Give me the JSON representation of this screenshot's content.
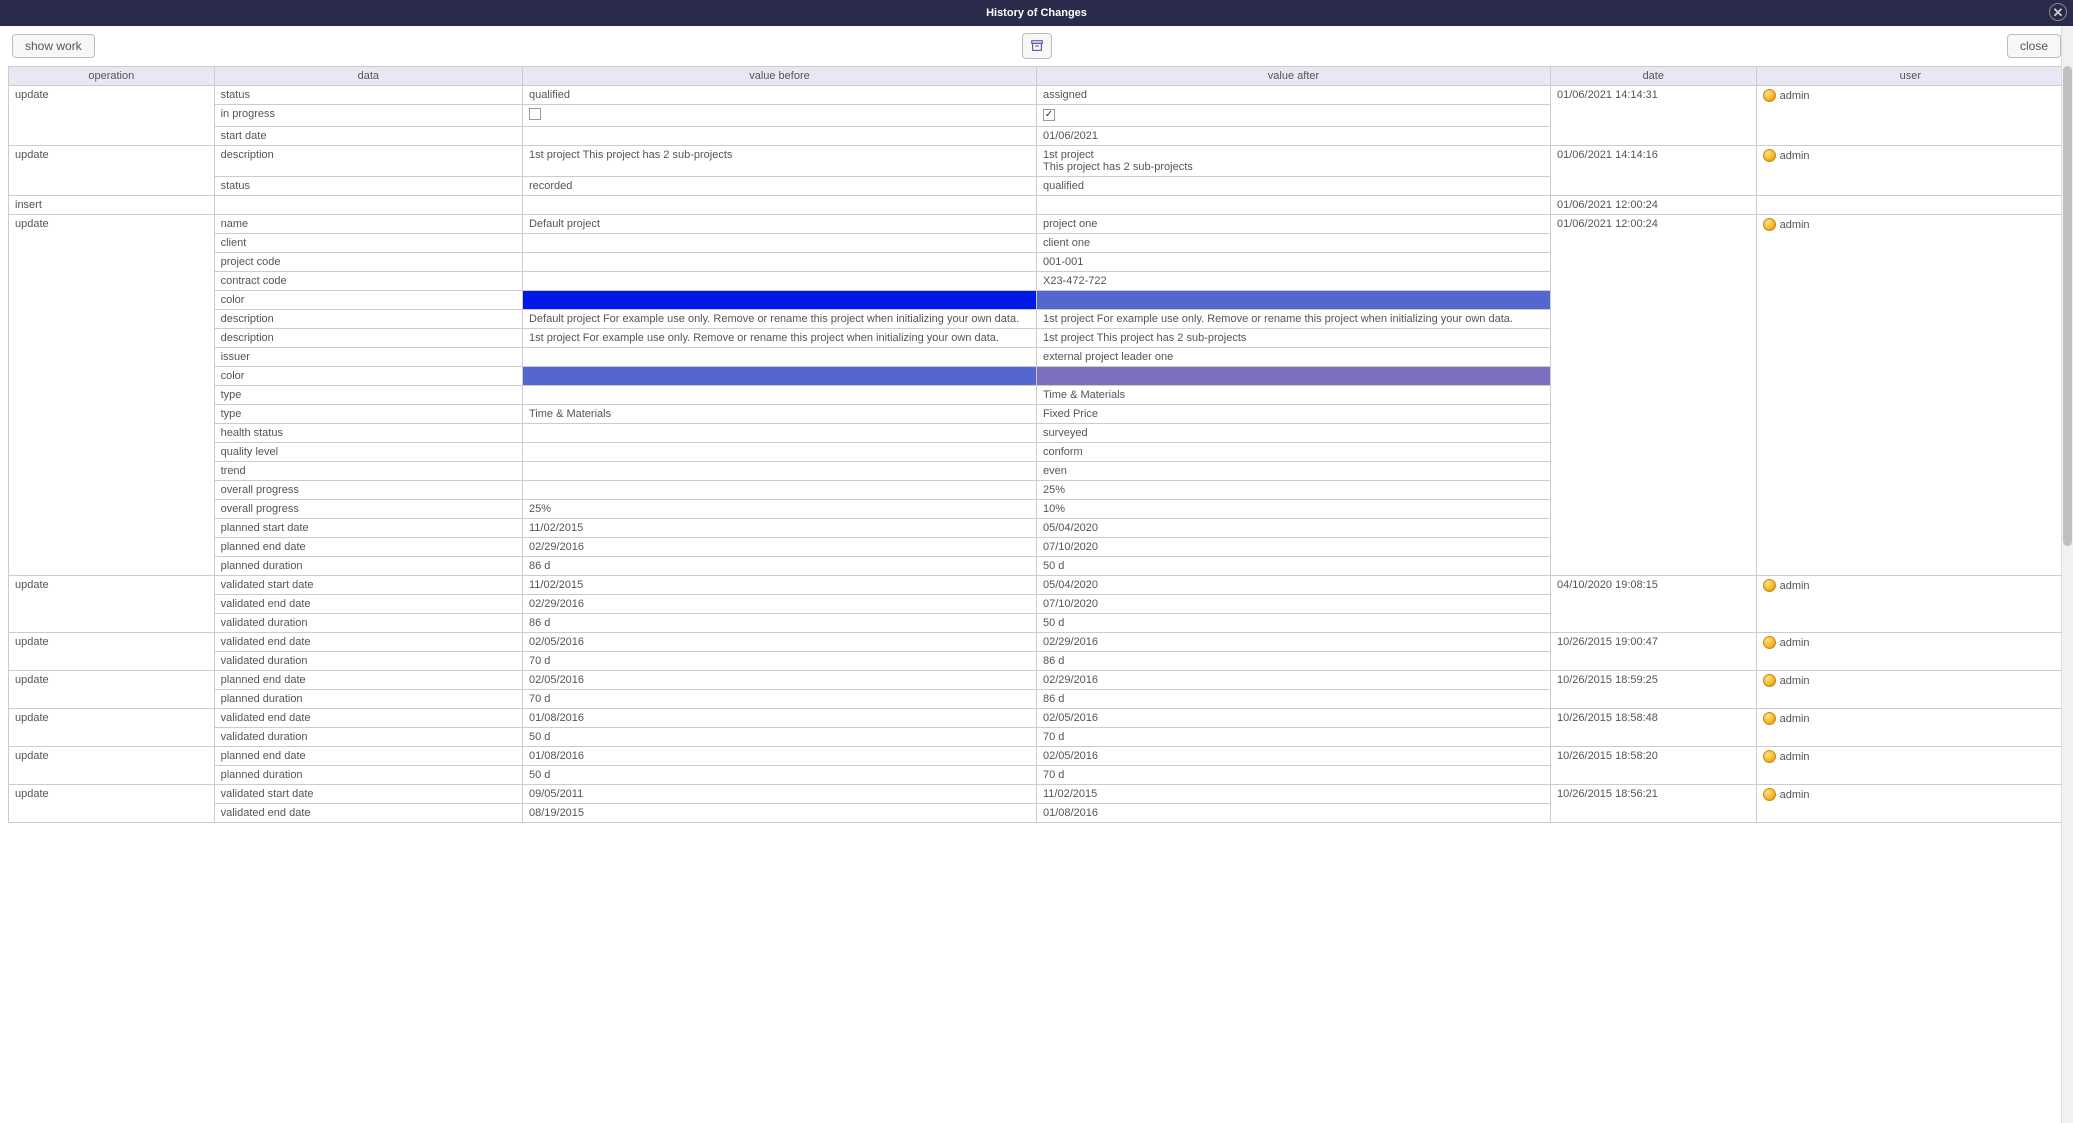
{
  "title": "History of Changes",
  "buttons": {
    "show_work": "show work",
    "close": "close"
  },
  "columns": {
    "operation": "operation",
    "data": "data",
    "value_before": "value before",
    "value_after": "value after",
    "date": "date",
    "user": "user"
  },
  "colors": {
    "blue_strong": "#0019e6",
    "blue_mid": "#5467d0",
    "purple": "#7c6fc0"
  },
  "rows": [
    {
      "operation": "update",
      "date": "01/06/2021 14:14:31",
      "user": "admin",
      "items": [
        {
          "data": "status",
          "before": "qualified",
          "after": "assigned"
        },
        {
          "data": "in progress",
          "before_chk": false,
          "after_chk": true
        },
        {
          "data": "start date",
          "before": "",
          "after": "01/06/2021"
        }
      ]
    },
    {
      "operation": "update",
      "date": "01/06/2021 14:14:16",
      "user": "admin",
      "items": [
        {
          "data": "description",
          "before": "1st project This project has 2 sub-projects",
          "after": "1st project\nThis project has 2 sub-projects"
        },
        {
          "data": "status",
          "before": "recorded",
          "after": "qualified"
        }
      ]
    },
    {
      "operation": "insert",
      "date": "01/06/2021 12:00:24",
      "user": "",
      "items": [
        {
          "data": "",
          "before": "",
          "after": ""
        }
      ]
    },
    {
      "operation": "update",
      "date": "01/06/2021 12:00:24",
      "user": "admin",
      "items": [
        {
          "data": "name",
          "before": "Default project",
          "after": "project one"
        },
        {
          "data": "client",
          "before": "",
          "after": "client one"
        },
        {
          "data": "project code",
          "before": "",
          "after": "001-001"
        },
        {
          "data": "contract code",
          "before": "",
          "after": "X23-472-722"
        },
        {
          "data": "color",
          "before_color": "blue_strong",
          "after_color": "blue_mid"
        },
        {
          "data": "description",
          "before": "Default project For example use only. Remove or rename this project when initializing your own data.",
          "after": "1st project For example use only. Remove or rename this project when initializing your own data."
        },
        {
          "data": "description",
          "before": "1st project For example use only. Remove or rename this project when initializing your own data.",
          "after": "1st project This project has 2 sub-projects"
        },
        {
          "data": "issuer",
          "before": "",
          "after": "external project leader one"
        },
        {
          "data": "color",
          "before_color": "blue_mid",
          "after_color": "purple"
        },
        {
          "data": "type",
          "before": "",
          "after": "Time & Materials"
        },
        {
          "data": "type",
          "before": "Time & Materials",
          "after": "Fixed Price"
        },
        {
          "data": "health status",
          "before": "",
          "after": "surveyed"
        },
        {
          "data": "quality level",
          "before": "",
          "after": "conform"
        },
        {
          "data": "trend",
          "before": "",
          "after": "even"
        },
        {
          "data": "overall progress",
          "before": "",
          "after": "25%"
        },
        {
          "data": "overall progress",
          "before": "25%",
          "after": "10%"
        },
        {
          "data": "planned start date",
          "before": "11/02/2015",
          "after": "05/04/2020"
        },
        {
          "data": "planned end date",
          "before": "02/29/2016",
          "after": "07/10/2020"
        },
        {
          "data": "planned duration",
          "before": "86 d",
          "after": "50 d"
        }
      ]
    },
    {
      "operation": "update",
      "date": "04/10/2020 19:08:15",
      "user": "admin",
      "items": [
        {
          "data": "validated start date",
          "before": "11/02/2015",
          "after": "05/04/2020"
        },
        {
          "data": "validated end date",
          "before": "02/29/2016",
          "after": "07/10/2020"
        },
        {
          "data": "validated duration",
          "before": "86 d",
          "after": "50 d"
        }
      ]
    },
    {
      "operation": "update",
      "date": "10/26/2015 19:00:47",
      "user": "admin",
      "items": [
        {
          "data": "validated end date",
          "before": "02/05/2016",
          "after": "02/29/2016"
        },
        {
          "data": "validated duration",
          "before": "70 d",
          "after": "86 d"
        }
      ]
    },
    {
      "operation": "update",
      "date": "10/26/2015 18:59:25",
      "user": "admin",
      "items": [
        {
          "data": "planned end date",
          "before": "02/05/2016",
          "after": "02/29/2016"
        },
        {
          "data": "planned duration",
          "before": "70 d",
          "after": "86 d"
        }
      ]
    },
    {
      "operation": "update",
      "date": "10/26/2015 18:58:48",
      "user": "admin",
      "items": [
        {
          "data": "validated end date",
          "before": "01/08/2016",
          "after": "02/05/2016"
        },
        {
          "data": "validated duration",
          "before": "50 d",
          "after": "70 d"
        }
      ]
    },
    {
      "operation": "update",
      "date": "10/26/2015 18:58:20",
      "user": "admin",
      "items": [
        {
          "data": "planned end date",
          "before": "01/08/2016",
          "after": "02/05/2016"
        },
        {
          "data": "planned duration",
          "before": "50 d",
          "after": "70 d"
        }
      ]
    },
    {
      "operation": "update",
      "date": "10/26/2015 18:56:21",
      "user": "admin",
      "items": [
        {
          "data": "validated start date",
          "before": "09/05/2011",
          "after": "11/02/2015"
        },
        {
          "data": "validated end date",
          "before": "08/19/2015",
          "after": "01/08/2016"
        }
      ]
    }
  ]
}
